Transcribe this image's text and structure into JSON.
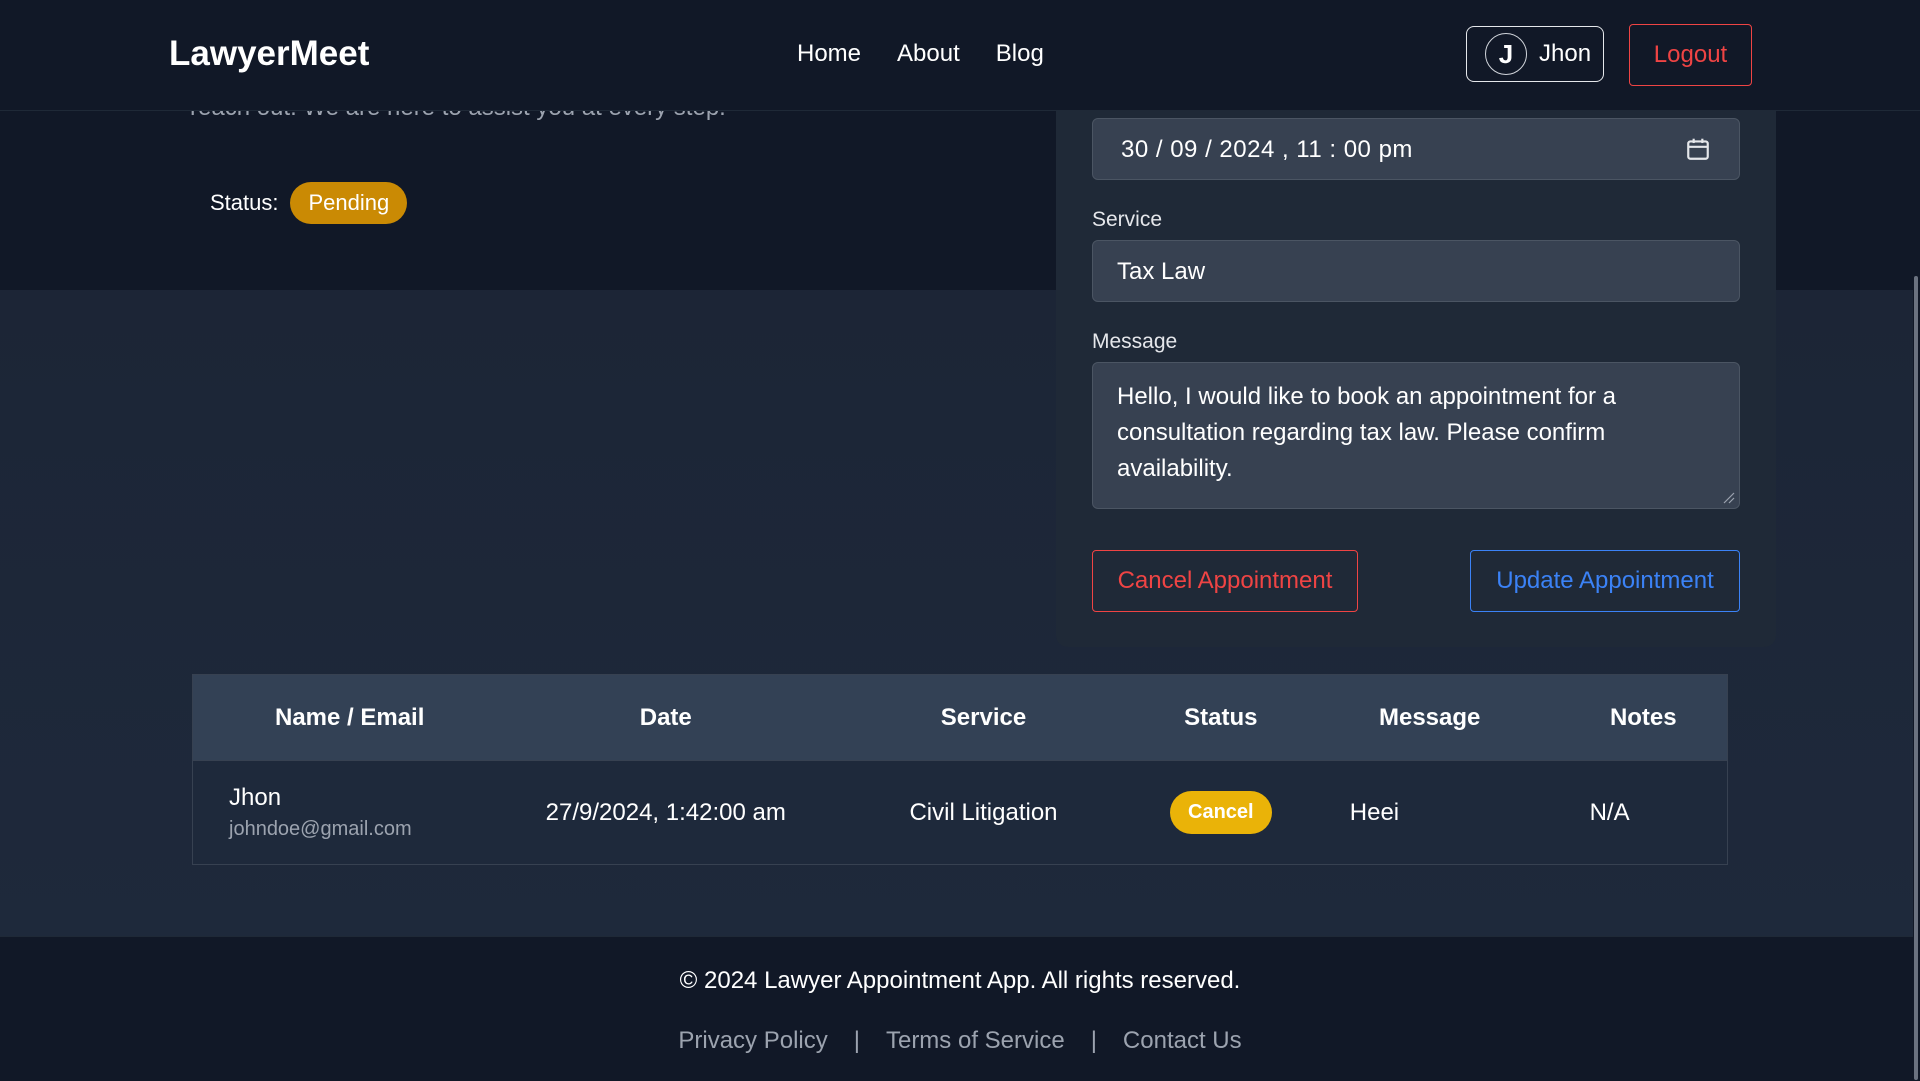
{
  "header": {
    "brand": "LawyerMeet",
    "nav": {
      "home": "Home",
      "about": "About",
      "blog": "Blog"
    },
    "user": {
      "initial": "J",
      "name": "Jhon"
    },
    "logout_label": "Logout"
  },
  "intro": {
    "text": "reach out. We are here to assist you at every step.",
    "status_label": "Status:",
    "status_value": "Pending"
  },
  "form": {
    "date_value": "30 / 09 / 2024 ,  11 : 00   pm",
    "service_label": "Service",
    "service_value": "Tax Law",
    "message_label": "Message",
    "message_value": "Hello, I would like to book an appointment for a consultation regarding tax law. Please confirm availability.",
    "cancel_label": "Cancel Appointment",
    "update_label": "Update Appointment"
  },
  "table": {
    "headers": {
      "name": "Name / Email",
      "date": "Date",
      "service": "Service",
      "status": "Status",
      "message": "Message",
      "notes": "Notes"
    },
    "rows": [
      {
        "name": "Jhon",
        "email": "johndoe@gmail.com",
        "date": "27/9/2024, 1:42:00 am",
        "service": "Civil Litigation",
        "status": "Cancel",
        "message": "Heei",
        "notes": "N/A"
      }
    ]
  },
  "footer": {
    "copyright": "© 2024 Lawyer Appointment App. All rights reserved.",
    "links": {
      "privacy": "Privacy Policy",
      "terms": "Terms of Service",
      "contact": "Contact Us"
    },
    "separator": "|"
  },
  "colors": {
    "accent_red": "#ef4444",
    "accent_blue": "#3b82f6",
    "pending": "#ca8a04",
    "cancel_badge": "#eab308"
  }
}
